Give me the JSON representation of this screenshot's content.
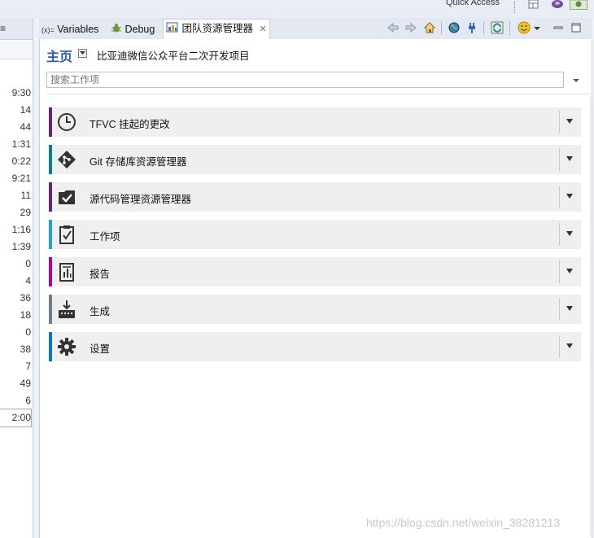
{
  "quick_access": {
    "label": "Quick Access"
  },
  "left_panel": {
    "tab_label": "≡",
    "rows": [
      "9:30",
      "14",
      "44",
      "1:31",
      "0:22",
      "9:21",
      "11",
      "29",
      "1:16",
      "1:39",
      "0",
      "4",
      "36",
      "18",
      "0",
      "38",
      "7",
      "49",
      "6",
      "2:00"
    ],
    "selected_index": 19
  },
  "tabs": [
    {
      "label": "Variables",
      "prefix": "(x)="
    },
    {
      "label": "Debug"
    },
    {
      "label": "团队资源管理器",
      "active": true
    }
  ],
  "toolbar_icons": [
    "back-icon",
    "forward-icon",
    "home-icon",
    "globe-icon",
    "connect-icon",
    "refresh-icon",
    "feedback-icon",
    "minimize-icon",
    "maximize-icon"
  ],
  "home": {
    "title": "主页",
    "project": "比亚迪微信公众平台二次开发项目"
  },
  "search": {
    "placeholder": "搜索工作项"
  },
  "sections": [
    {
      "label": "TFVC 挂起的更改",
      "color": "#68217a",
      "icon": "clock-icon"
    },
    {
      "label": "Git 存储库资源管理器",
      "color": "#00828b",
      "icon": "git-icon"
    },
    {
      "label": "源代码管理资源管理器",
      "color": "#68217a",
      "icon": "source-control-icon"
    },
    {
      "label": "工作项",
      "color": "#1ba1e2",
      "icon": "work-items-icon"
    },
    {
      "label": "报告",
      "color": "#b4009e",
      "icon": "reports-icon"
    },
    {
      "label": "生成",
      "color": "#6d7f8b",
      "icon": "builds-icon"
    },
    {
      "label": "设置",
      "color": "#007acc",
      "icon": "gear-icon"
    }
  ],
  "watermark": "https://blog.csdn.net/weixin_38281213"
}
